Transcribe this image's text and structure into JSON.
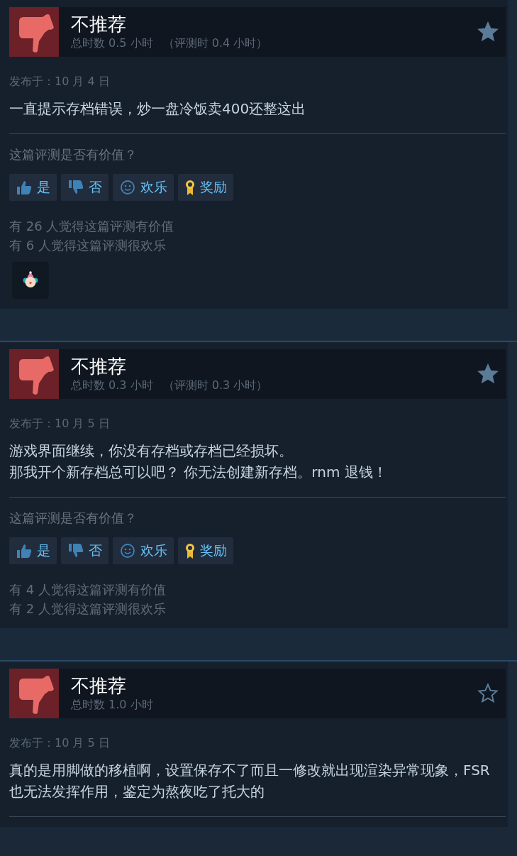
{
  "reviews": [
    {
      "verdict": "不推荐",
      "playtime": "总时数 0.5 小时",
      "review_time": "（评测时 0.4 小时）",
      "starred": true,
      "date": "发布于：10 月 4 日",
      "body": [
        "一直提示存档错误，炒一盘冷饭卖400还整这出"
      ],
      "helpful_prompt": "这篇评测是否有价值？",
      "buttons": [
        {
          "kind": "yes",
          "label": "是"
        },
        {
          "kind": "no",
          "label": "否"
        },
        {
          "kind": "funny",
          "label": "欢乐"
        },
        {
          "kind": "award",
          "label": "奖励"
        }
      ],
      "counts": [
        "有 26 人觉得这篇评测有价值",
        "有 6 人觉得这篇评测很欢乐"
      ],
      "awards": [
        {
          "kind": "clown"
        }
      ]
    },
    {
      "verdict": "不推荐",
      "playtime": "总时数 0.3 小时",
      "review_time": "（评测时 0.3 小时）",
      "starred": true,
      "date": "发布于：10 月 5 日",
      "body": [
        "游戏界面继续，你没有存档或存档已经损坏。",
        "那我开个新存档总可以吧？ 你无法创建新存档。rnm 退钱！"
      ],
      "helpful_prompt": "这篇评测是否有价值？",
      "buttons": [
        {
          "kind": "yes",
          "label": "是"
        },
        {
          "kind": "no",
          "label": "否"
        },
        {
          "kind": "funny",
          "label": "欢乐"
        },
        {
          "kind": "award",
          "label": "奖励"
        }
      ],
      "counts": [
        "有 4 人觉得这篇评测有价值",
        "有 2 人觉得这篇评测很欢乐"
      ]
    },
    {
      "verdict": "不推荐",
      "playtime": "总时数 1.0 小时",
      "starred": false,
      "date": "发布于：10 月 5 日",
      "body": [
        "真的是用脚做的移植啊，设置保存不了而且一修改就出现渲染异常现象，FSR也无法发挥作用，鉴定为熬夜吃了托大的"
      ]
    }
  ]
}
